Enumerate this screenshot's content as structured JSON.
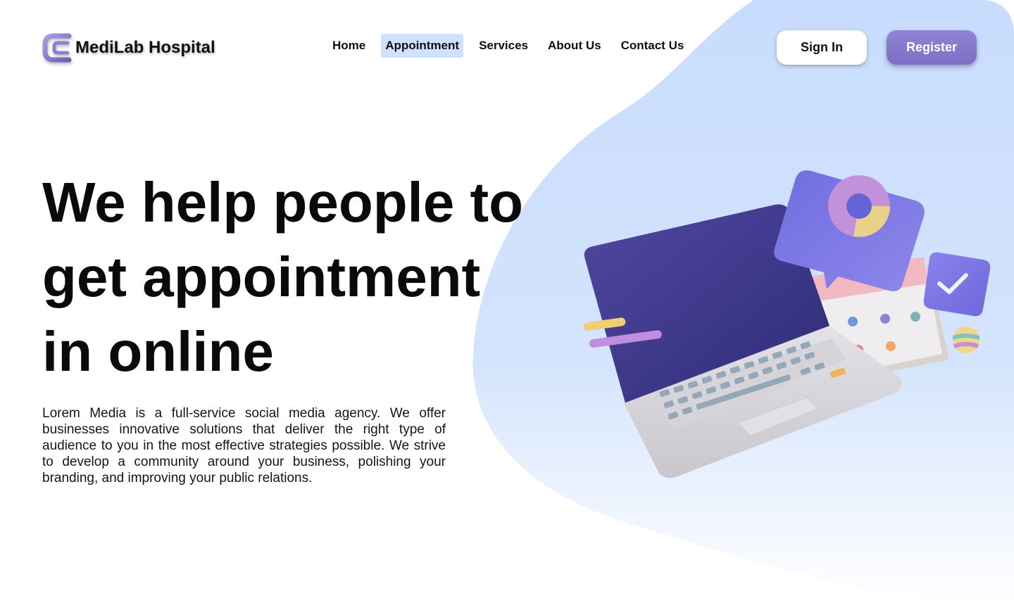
{
  "brand": {
    "name": "MediLab Hospital",
    "logo_icon": "medilab-logo-icon"
  },
  "nav": {
    "items": [
      {
        "label": "Home",
        "active": false
      },
      {
        "label": "Appointment",
        "active": true
      },
      {
        "label": "Services",
        "active": false
      },
      {
        "label": "About Us",
        "active": false
      },
      {
        "label": "Contact Us",
        "active": false
      }
    ]
  },
  "actions": {
    "sign_in": "Sign In",
    "register": "Register"
  },
  "hero": {
    "title_lines": [
      "We help people to",
      "get appointment",
      "in online"
    ],
    "description": "Lorem Media is a full-service social media agency. We offer businesses innovative solutions that deliver the right type of audience to you in the most effective strategies possible. We strive to develop a community around your business, polishing your branding, and improving your public relations.",
    "illustration_icon": "laptop-calendar-illustration"
  },
  "colors": {
    "accent": "#8277cc",
    "active_nav_bg": "#cfe1fd",
    "background_blob": "#cfe0fd",
    "text": "#0c0c0c"
  }
}
